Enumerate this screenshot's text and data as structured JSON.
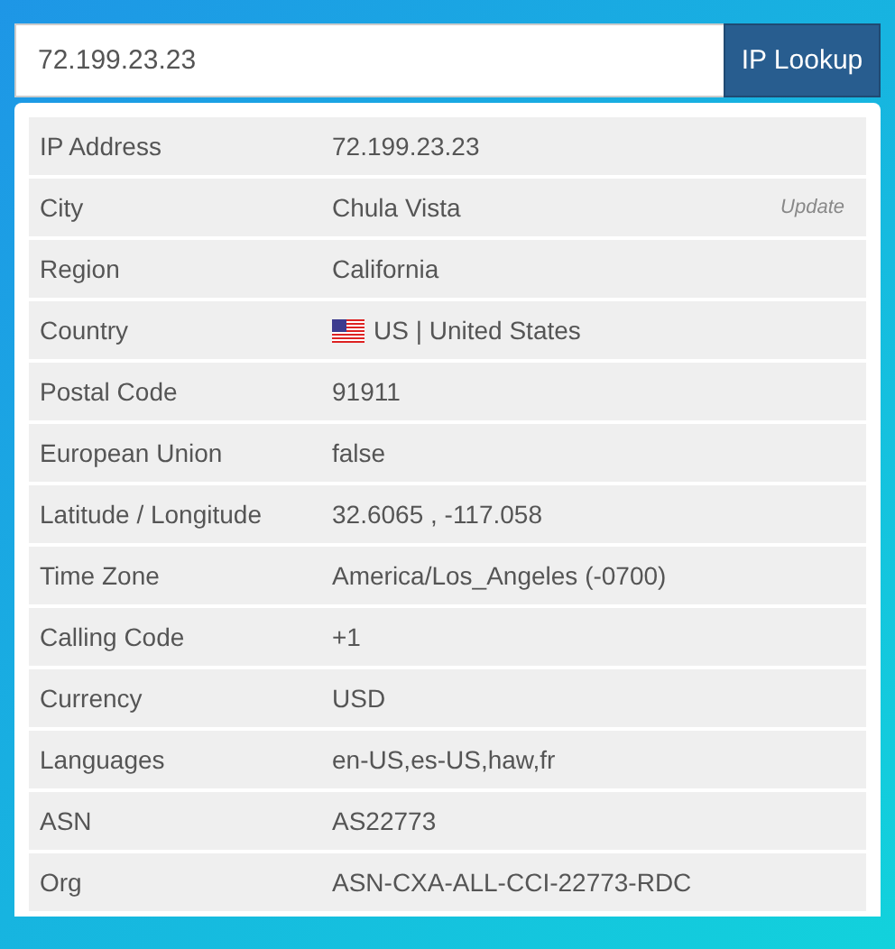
{
  "search": {
    "value": "72.199.23.23",
    "button": "IP Lookup"
  },
  "rows": [
    {
      "kind": "text",
      "label": "IP Address",
      "value": "72.199.23.23"
    },
    {
      "kind": "text",
      "label": "City",
      "value": "Chula Vista",
      "action": "Update"
    },
    {
      "kind": "text",
      "label": "Region",
      "value": "California"
    },
    {
      "kind": "flag",
      "label": "Country",
      "value": "US | United States"
    },
    {
      "kind": "text",
      "label": "Postal Code",
      "value": "91911"
    },
    {
      "kind": "text",
      "label": "European Union",
      "value": "false"
    },
    {
      "kind": "text",
      "label": "Latitude / Longitude",
      "value": "32.6065 , -117.058"
    },
    {
      "kind": "text",
      "label": "Time Zone",
      "value": "America/Los_Angeles (-0700)"
    },
    {
      "kind": "text",
      "label": "Calling Code",
      "value": "+1"
    },
    {
      "kind": "text",
      "label": "Currency",
      "value": "USD"
    },
    {
      "kind": "text",
      "label": "Languages",
      "value": "en-US,es-US,haw,fr"
    },
    {
      "kind": "text",
      "label": "ASN",
      "value": "AS22773"
    },
    {
      "kind": "text",
      "label": "Org",
      "value": "ASN-CXA-ALL-CCI-22773-RDC"
    }
  ]
}
